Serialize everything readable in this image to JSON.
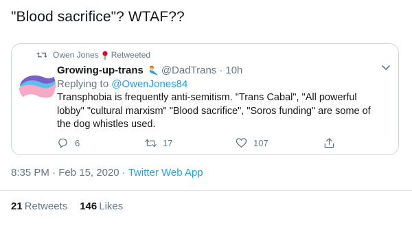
{
  "tweet": {
    "text": "\"Blood sacrifice\"? WTAF??",
    "time": "8:35 PM",
    "date": "Feb 15, 2020",
    "separator": "·",
    "source": "Twitter Web App",
    "retweets_count": "21",
    "retweets_label": "Retweets",
    "likes_count": "146",
    "likes_label": "Likes"
  },
  "quoted": {
    "retweeted_by": "Owen Jones",
    "retweeted_label": "Retweeted",
    "author_name": "Growing-up-trans",
    "handle": "@DadTrans",
    "time": "10h",
    "replying_label": "Replying to",
    "replying_to": "@OwenJones84",
    "text": "Transphobia is frequently anti-semitism. \"Trans Cabal\", \"All powerful lobby\" \"cultural marxism\" \"Blood sacrifice\", \"Soros funding\" are some of the dog whistles used.",
    "reply_count": "6",
    "retweet_count": "17",
    "like_count": "107"
  },
  "colors": {
    "accent": "#1da1f2",
    "muted": "#657786",
    "text": "#14171a",
    "border": "#ccd6dd"
  },
  "icons": {
    "retweet": "retweet-icon",
    "rose": "rose-icon",
    "emoji": "mermaid-emoji-icon",
    "chevron": "chevron-down-icon",
    "reply": "reply-icon",
    "like": "heart-icon",
    "share": "share-icon"
  }
}
